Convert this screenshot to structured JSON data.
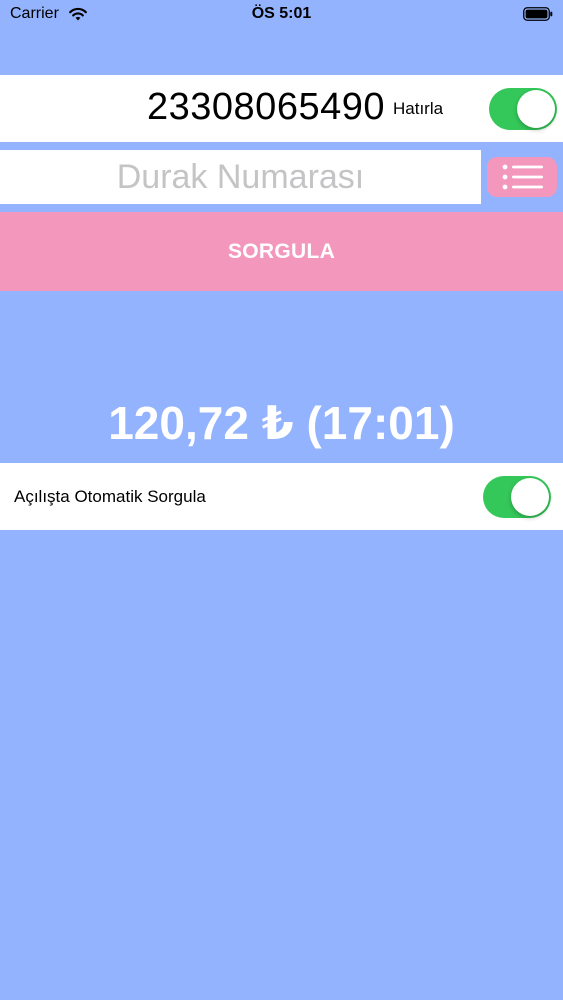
{
  "status_bar": {
    "carrier": "Carrier",
    "time": "ÖS 5:01",
    "wifi_icon": "wifi-icon",
    "battery_icon": "battery-icon"
  },
  "card": {
    "number": "23308065490",
    "remember_label": "Hatırla",
    "remember_on": true
  },
  "stop": {
    "placeholder": "Durak Numarası",
    "value": "",
    "list_icon": "list-icon"
  },
  "query_button": {
    "label": "SORGULA"
  },
  "balance": {
    "text": "120,72 ₺ (17:01)"
  },
  "auto_query": {
    "label": "Açılışta Otomatik Sorgula",
    "enabled": true
  },
  "colors": {
    "background": "#93b3ff",
    "accent_pink": "#f497bd",
    "toggle_on": "#34c759",
    "white": "#ffffff"
  }
}
